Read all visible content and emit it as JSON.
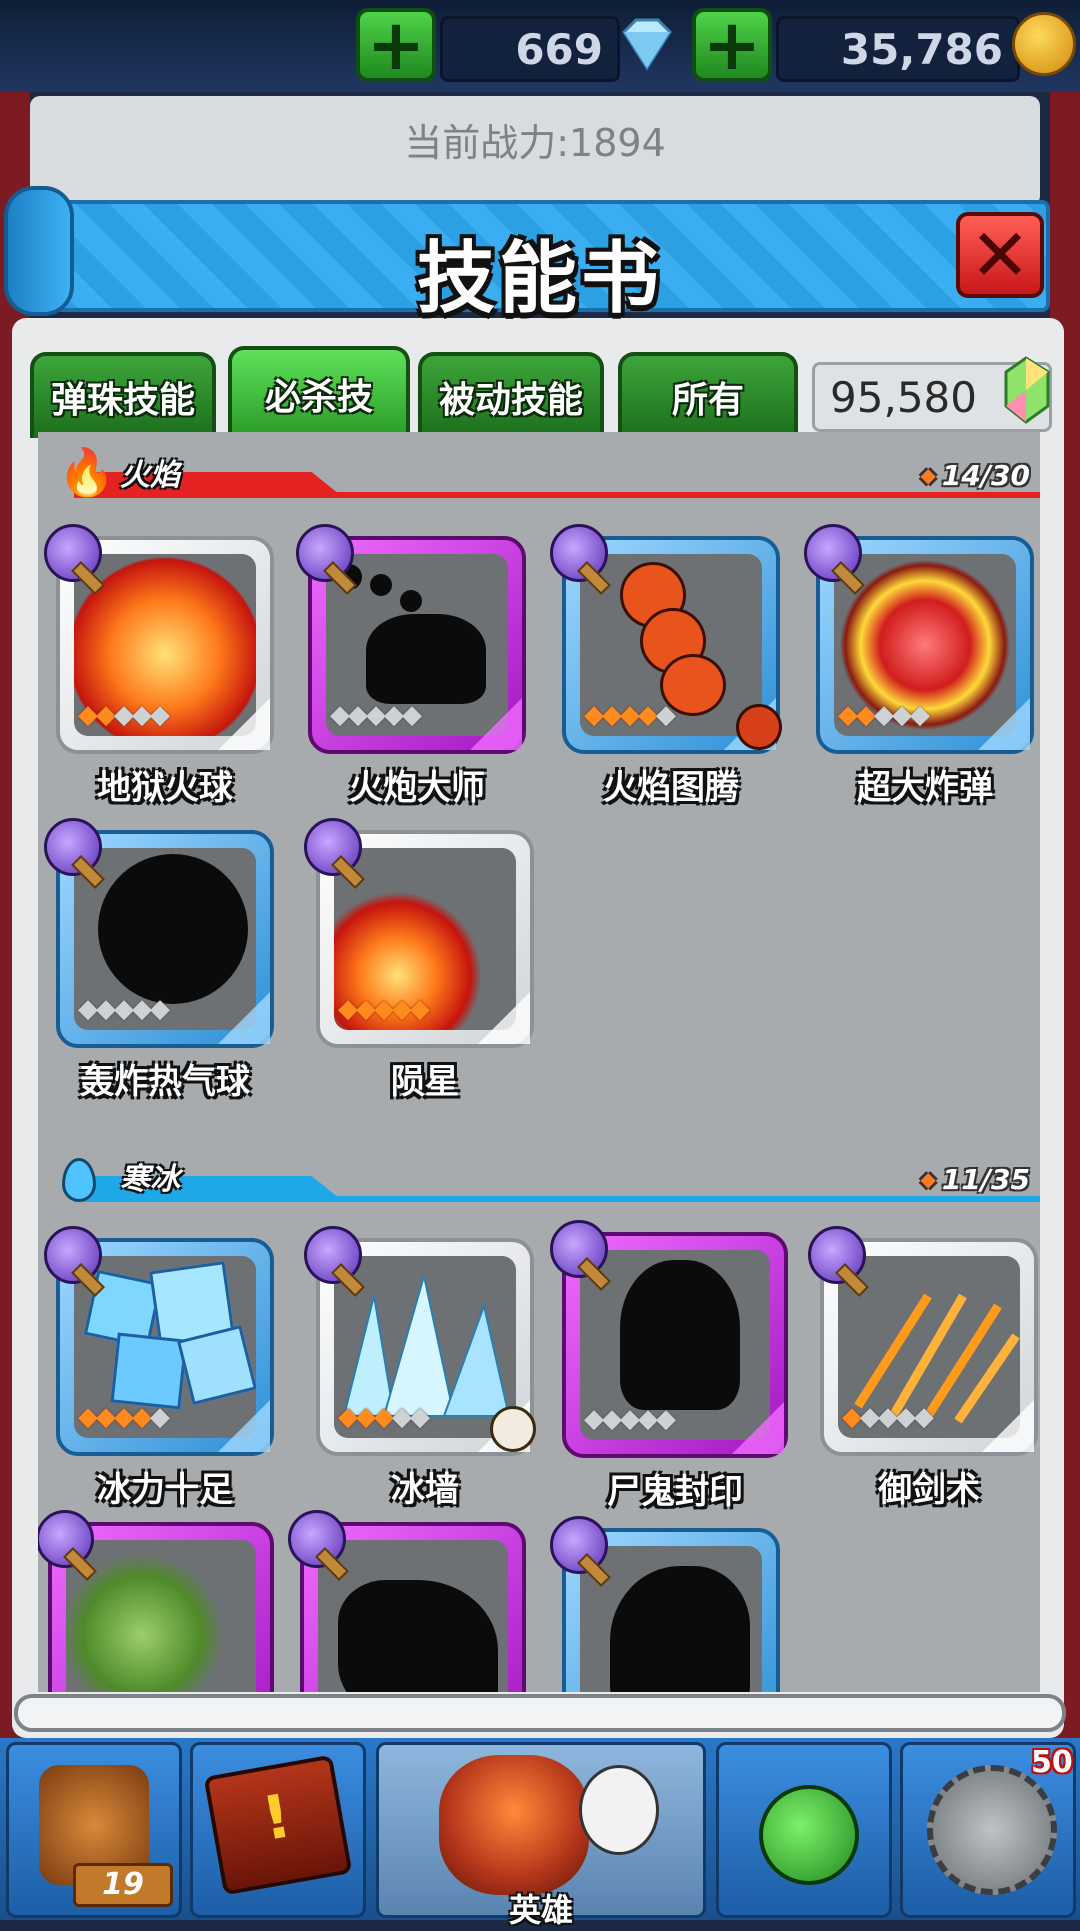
{
  "currency": {
    "diamonds": "669",
    "coins": "35,786",
    "diamond_icon": "diamond-icon",
    "coin_icon": "coin-icon"
  },
  "power": {
    "label": "当前战力:1894"
  },
  "dialog": {
    "title": "技能书"
  },
  "tabs": [
    {
      "label": "弹珠技能",
      "active": false
    },
    {
      "label": "必杀技",
      "active": true
    },
    {
      "label": "被动技能",
      "active": false
    },
    {
      "label": "所有",
      "active": false
    }
  ],
  "gems": {
    "value": "95,580"
  },
  "sections": [
    {
      "name": "火焰",
      "count": "14/30",
      "color": "#e52222",
      "skills": [
        {
          "name": "地狱火球",
          "stars": 2,
          "frame": "white",
          "locked": false
        },
        {
          "name": "火炮大师",
          "stars": 0,
          "frame": "purple",
          "locked": true
        },
        {
          "name": "火焰图腾",
          "stars": 4,
          "frame": "blue",
          "locked": false
        },
        {
          "name": "超大炸弹",
          "stars": 2,
          "frame": "blue",
          "locked": false
        },
        {
          "name": "轰炸热气球",
          "stars": 0,
          "frame": "blue",
          "locked": true
        },
        {
          "name": "陨星",
          "stars": 5,
          "frame": "white",
          "locked": false
        }
      ]
    },
    {
      "name": "寒冰",
      "count": "11/35",
      "color": "#1ea8e8",
      "skills": [
        {
          "name": "冰力十足",
          "stars": 4,
          "frame": "blue",
          "locked": false
        },
        {
          "name": "冰墙",
          "stars": 3,
          "frame": "white",
          "locked": false
        },
        {
          "name": "尸鬼封印",
          "stars": 0,
          "frame": "purple",
          "locked": true
        },
        {
          "name": "御剑术",
          "stars": 1,
          "frame": "white",
          "locked": false
        },
        {
          "name": "",
          "stars": 0,
          "frame": "purple",
          "locked": false
        },
        {
          "name": "",
          "stars": 0,
          "frame": "purple",
          "locked": true
        },
        {
          "name": "",
          "stars": 0,
          "frame": "blue",
          "locked": true
        }
      ]
    }
  ],
  "bottom_nav": {
    "shop_badge": "19",
    "hero_label": "英雄",
    "lock_badge": "50"
  }
}
